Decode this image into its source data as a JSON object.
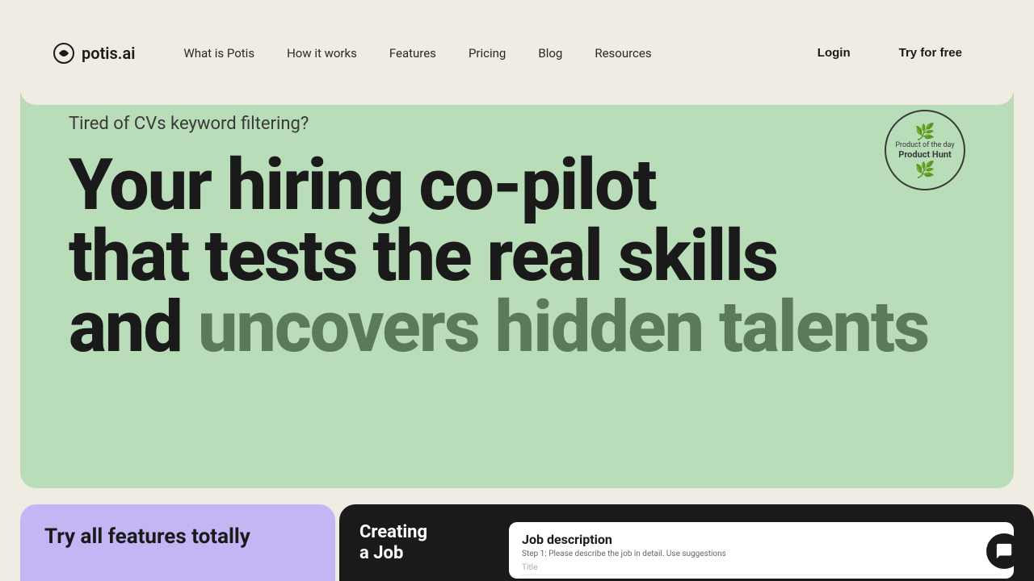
{
  "page": {
    "background_color": "#f0ebe3",
    "green_color": "#b8ddb8",
    "purple_color": "#c4b5f5",
    "dark_color": "#1a1a1a"
  },
  "logo": {
    "text": "potis.ai"
  },
  "nav": {
    "links": [
      {
        "label": "What is Potis",
        "id": "what-is-potis"
      },
      {
        "label": "How it works",
        "id": "how-it-works"
      },
      {
        "label": "Features",
        "id": "features"
      },
      {
        "label": "Pricing",
        "id": "pricing"
      },
      {
        "label": "Blog",
        "id": "blog"
      },
      {
        "label": "Resources",
        "id": "resources"
      }
    ],
    "login_label": "Login",
    "try_free_label": "Try for free"
  },
  "hero": {
    "subtitle": "Tired of CVs keyword filtering?",
    "title_line1": "Your hiring co-pilot",
    "title_line2": "that tests the real skills",
    "title_line3_plain": "and ",
    "title_line3_highlight": "uncovers hidden talents"
  },
  "badge": {
    "line1": "Product of the day",
    "line2": "Product Hunt"
  },
  "bottom_left": {
    "title": "Try all features totally"
  },
  "bottom_right": {
    "subtitle_line1": "Creating",
    "subtitle_line2": "a Job"
  },
  "job_panel": {
    "title": "Job description",
    "step": "Step 1: Please describe the job in detail. Use suggestions",
    "field_label": "Title"
  },
  "chat": {
    "icon": "💬"
  }
}
